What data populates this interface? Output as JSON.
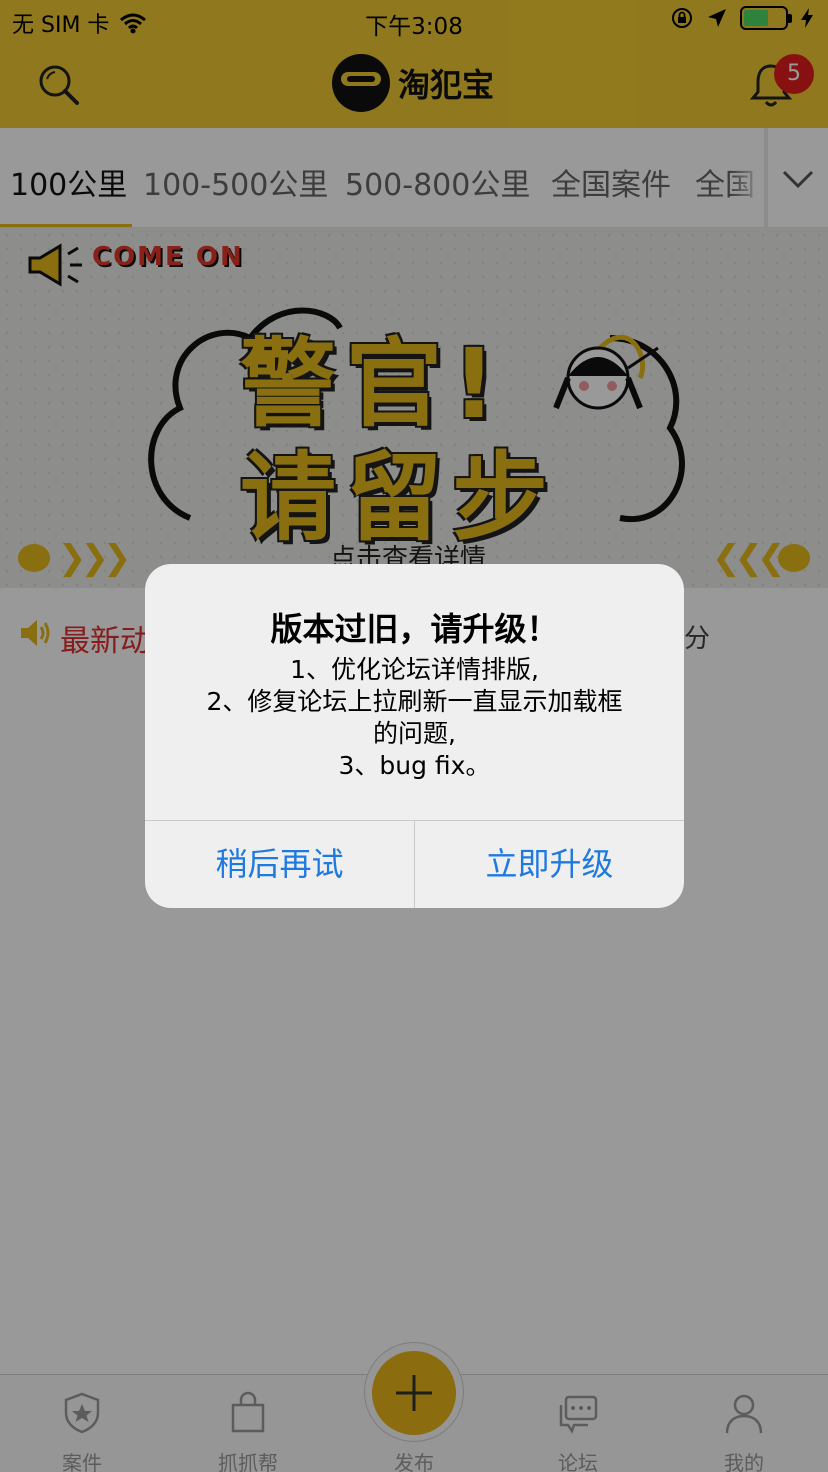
{
  "status_bar": {
    "carrier": "无 SIM 卡",
    "time": "下午3:08"
  },
  "nav": {
    "title": "淘犯宝",
    "notification_count": "5"
  },
  "tabs": [
    {
      "label": "100公里",
      "active": true
    },
    {
      "label": "100-500公里"
    },
    {
      "label": "500-800公里"
    },
    {
      "label": "全国案件"
    },
    {
      "label": "全国"
    }
  ],
  "banner": {
    "come_on": "COME ON",
    "headline_line1": "警官!",
    "headline_line2": "请留步",
    "subtitle": "点击查看详情"
  },
  "notice": {
    "prefix": "最新动",
    "suffix": "分"
  },
  "alert": {
    "title": "版本过旧，请升级！",
    "message_lines": [
      "1、优化论坛详情排版,",
      "2、修复论坛上拉刷新一直显示加载框",
      "的问题,",
      "3、bug fix。"
    ],
    "cancel_label": "稍后再试",
    "confirm_label": "立即升级"
  },
  "tabbar": {
    "items": [
      {
        "label": "案件",
        "icon": "shield-star-icon"
      },
      {
        "label": "抓抓帮",
        "icon": "bag-icon"
      },
      {
        "label": "发布",
        "icon": "plus-icon"
      },
      {
        "label": "论坛",
        "icon": "chat-icon"
      },
      {
        "label": "我的",
        "icon": "person-icon"
      }
    ]
  },
  "colors": {
    "brand_yellow": "#f1c932",
    "alert_button_blue": "#1f7ae0",
    "notice_red": "#e03030"
  }
}
